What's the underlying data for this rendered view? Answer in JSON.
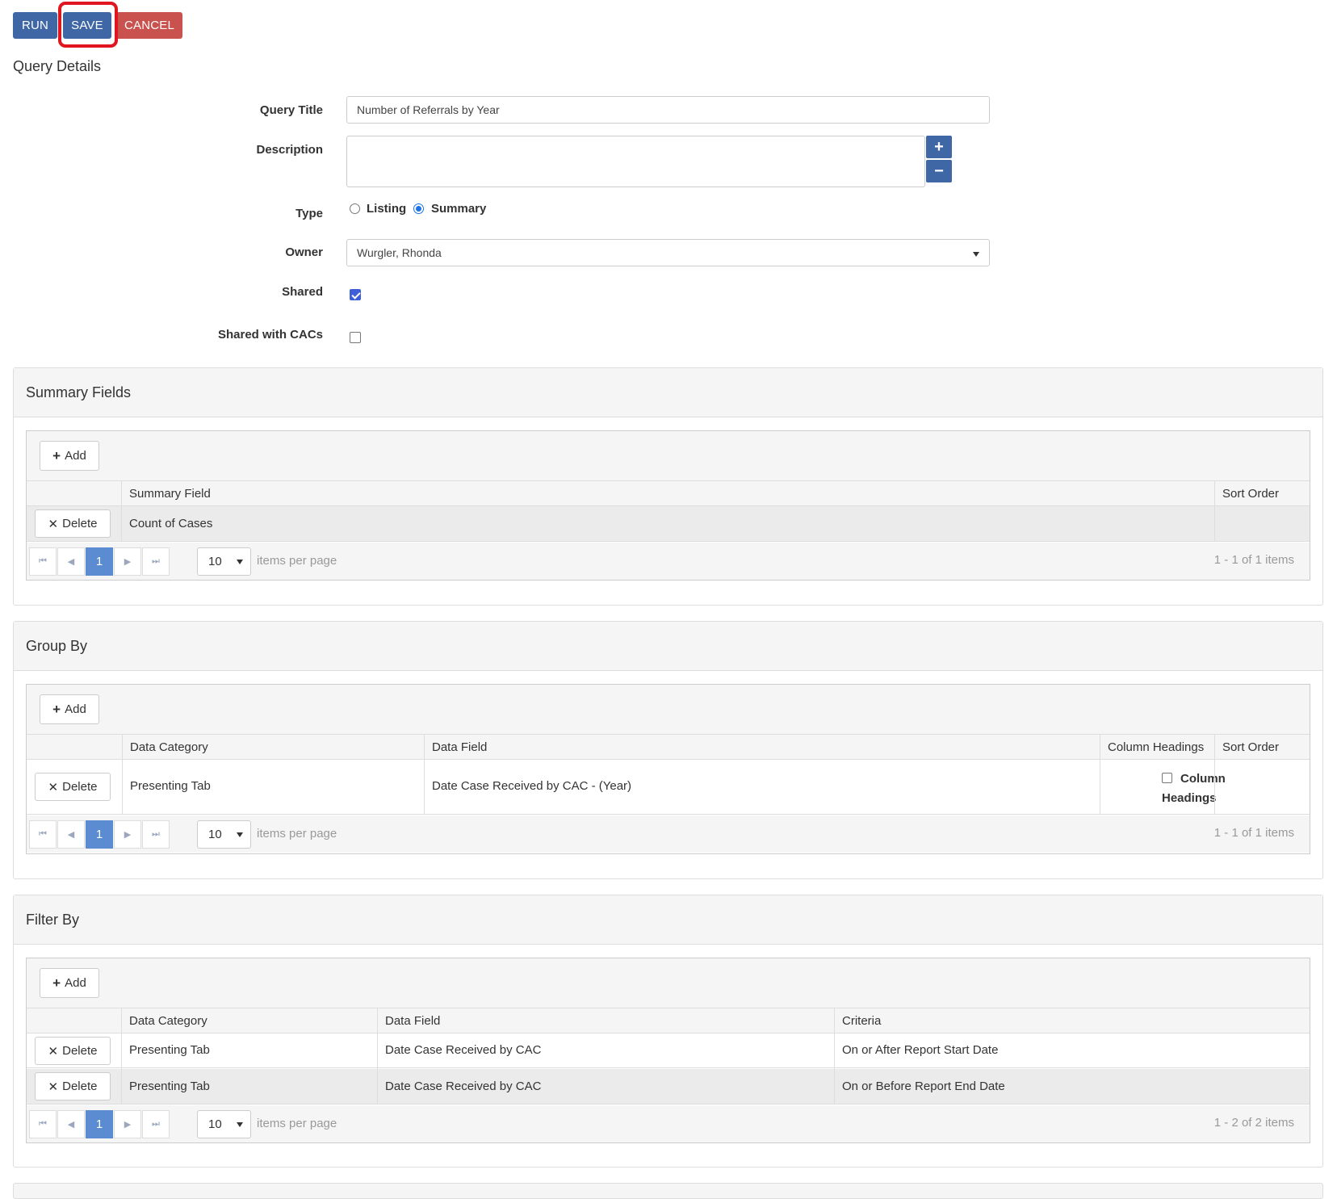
{
  "toolbar": {
    "run": "RUN",
    "save": "SAVE",
    "cancel": "CANCEL"
  },
  "query_details": {
    "title": "Query Details",
    "query_title_label": "Query Title",
    "query_title_value": "Number of Referrals by Year",
    "description_label": "Description",
    "description_value": "",
    "plus": "+",
    "minus": "−",
    "type_label": "Type",
    "type_options": [
      "Listing",
      "Summary"
    ],
    "type_selected": "Summary",
    "owner_label": "Owner",
    "owner_value": "Wurgler, Rhonda",
    "shared_label": "Shared",
    "shared_checked": true,
    "shared_cacs_label": "Shared with CACs",
    "shared_cacs_checked": false
  },
  "common": {
    "add": "Add",
    "delete": "Delete",
    "page": "1",
    "per_page": "10",
    "items_per_page": "items per page"
  },
  "summary_fields": {
    "title": "Summary Fields",
    "columns": [
      "Summary Field",
      "Sort Order"
    ],
    "rows": [
      {
        "summary_field": "Count of Cases",
        "sort_order": ""
      }
    ],
    "info": "1 - 1 of 1 items"
  },
  "group_by": {
    "title": "Group By",
    "columns": [
      "Data Category",
      "Data Field",
      "Column Headings",
      "Sort Order"
    ],
    "rows": [
      {
        "data_category": "Presenting Tab",
        "data_field": "Date Case Received by CAC - (Year)",
        "column_headings_line1": "Column",
        "column_headings_line2": "Headings",
        "column_headings_checked": false,
        "sort_order": ""
      }
    ],
    "info": "1 - 1 of 1 items"
  },
  "filter_by": {
    "title": "Filter By",
    "columns": [
      "Data Category",
      "Data Field",
      "Criteria"
    ],
    "rows": [
      {
        "data_category": "Presenting Tab",
        "data_field": "Date Case Received by CAC",
        "criteria": "On or After Report Start Date"
      },
      {
        "data_category": "Presenting Tab",
        "data_field": "Date Case Received by CAC",
        "criteria": "On or Before Report End Date"
      }
    ],
    "info": "1 - 2 of 2 items"
  }
}
